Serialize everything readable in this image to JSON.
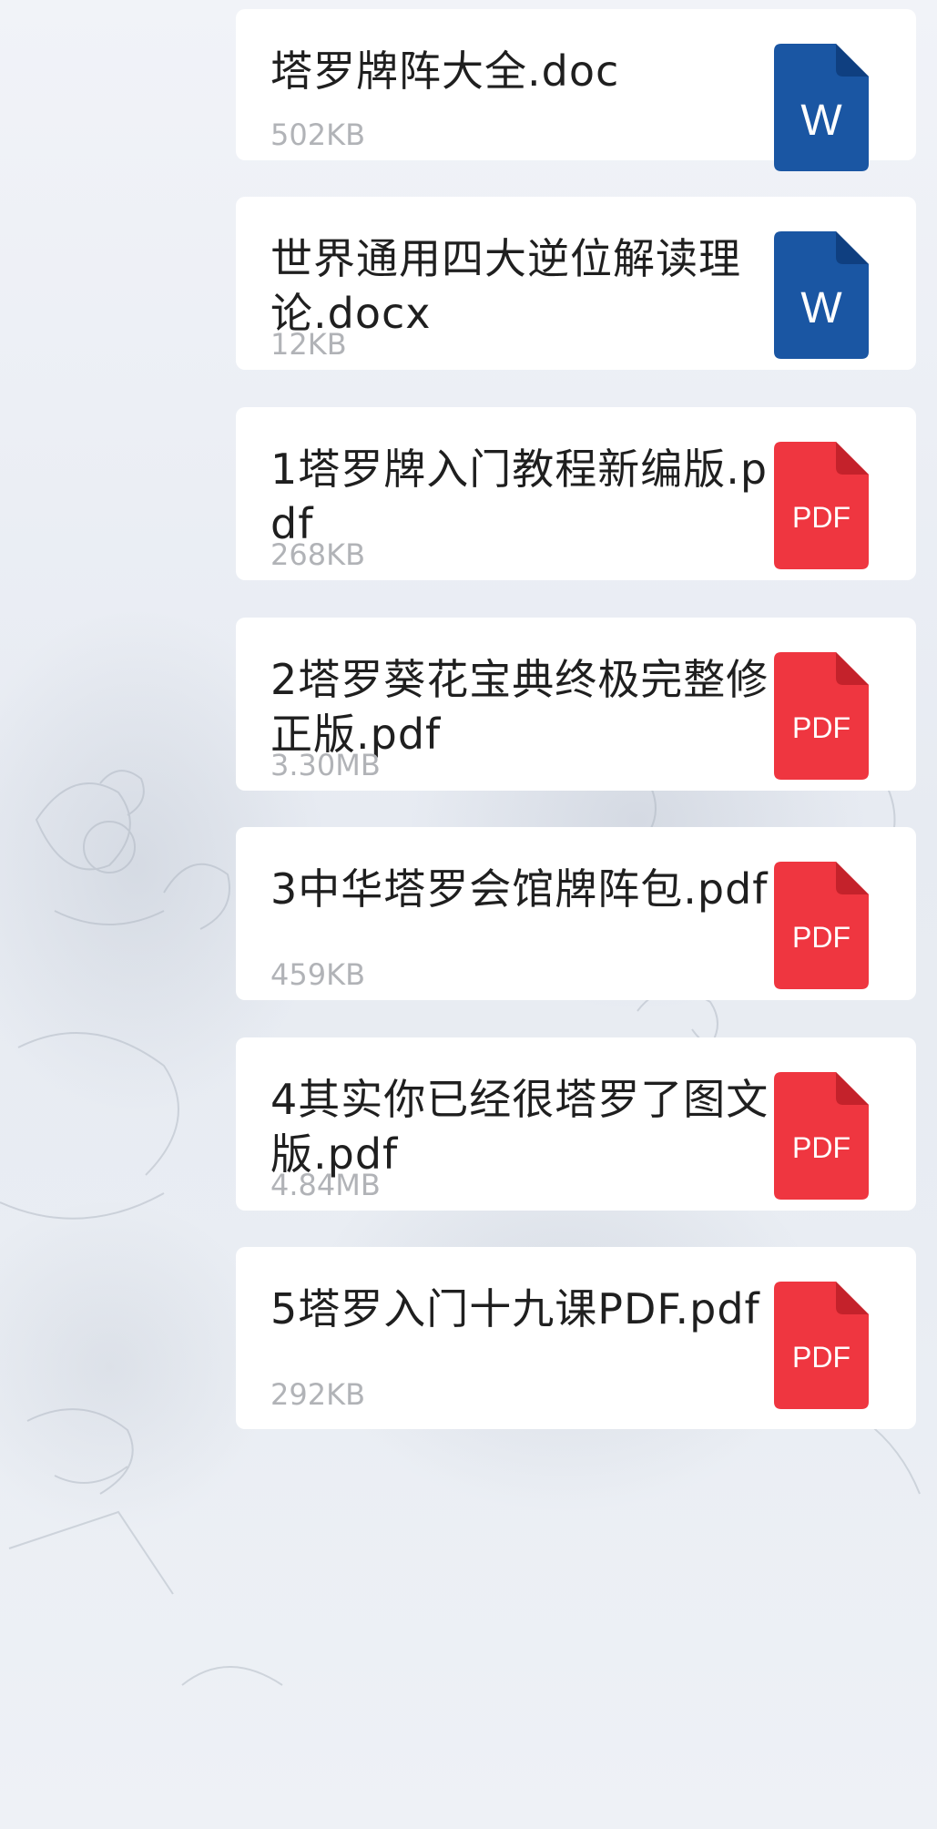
{
  "colors": {
    "word_blue": "#1a56a3",
    "word_fold": "#0f3f80",
    "pdf_red": "#ef3640",
    "pdf_fold": "#c4222b",
    "card_bg": "#ffffff",
    "name_text": "#1f1f1f",
    "size_text": "#b1b3b7"
  },
  "files": [
    {
      "name": "塔罗牌阵大全.doc",
      "size": "502KB",
      "icon": "word-icon",
      "icon_label": "W"
    },
    {
      "name": "世界通用四大逆位解读理论.docx",
      "size": "12KB",
      "icon": "word-icon",
      "icon_label": "W"
    },
    {
      "name": "1塔罗牌入门教程新编版.pdf",
      "size": "268KB",
      "icon": "pdf-icon",
      "icon_label": "PDF"
    },
    {
      "name": "2塔罗葵花宝典终极完整修正版.pdf",
      "size": "3.30MB",
      "icon": "pdf-icon",
      "icon_label": "PDF"
    },
    {
      "name": "3中华塔罗会馆牌阵包.pdf",
      "size": "459KB",
      "icon": "pdf-icon",
      "icon_label": "PDF"
    },
    {
      "name": "4其实你已经很塔罗了图文版.pdf",
      "size": "4.84MB",
      "icon": "pdf-icon",
      "icon_label": "PDF"
    },
    {
      "name": "5塔罗入门十九课PDF.pdf",
      "size": "292KB",
      "icon": "pdf-icon",
      "icon_label": "PDF"
    }
  ]
}
